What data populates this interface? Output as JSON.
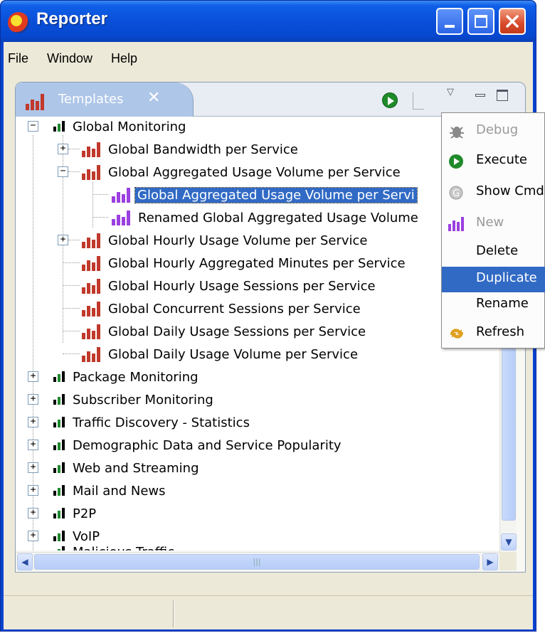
{
  "window": {
    "title": "Reporter",
    "buttons": {
      "minimize": "minimize-icon",
      "maximize": "maximize-icon",
      "close": "close-icon"
    }
  },
  "menubar": {
    "items": [
      "File",
      "Window",
      "Help"
    ]
  },
  "view": {
    "tab_label": "Templates",
    "tab_close": "✕",
    "toolbar": {
      "run": "run-icon",
      "menu": "▽"
    }
  },
  "tree": {
    "global_monitoring": "Global Monitoring",
    "children": [
      "Global Bandwidth per Service",
      "Global Aggregated Usage Volume per Service",
      "Global Aggregated Usage Volume per Servi",
      "Renamed Global Aggregated Usage Volume",
      "Global Hourly Usage Volume per Service",
      "Global Hourly Aggregated Minutes per Service",
      "Global Hourly Usage Sessions per Service",
      "Global Concurrent Sessions per Service",
      "Global Daily Usage Sessions per Service",
      "Global Daily Usage Volume per Service"
    ],
    "groups": [
      "Package Monitoring",
      "Subscriber Monitoring",
      "Traffic Discovery - Statistics",
      "Demographic Data and Service Popularity",
      "Web and Streaming",
      "Mail and News",
      "P2P",
      "VoIP",
      "Malicious Traffic"
    ]
  },
  "context_menu": {
    "items": [
      "Debug",
      "Execute",
      "Show Cmd",
      "New",
      "Delete",
      "Duplicate",
      "Rename",
      "Refresh"
    ],
    "highlight_color": "#316ac5"
  },
  "colors": {
    "selection": "#316ac5",
    "titlebar": "#0a4fd8",
    "bars": "#c0392b",
    "bars_selected": "#9b3fe0"
  }
}
